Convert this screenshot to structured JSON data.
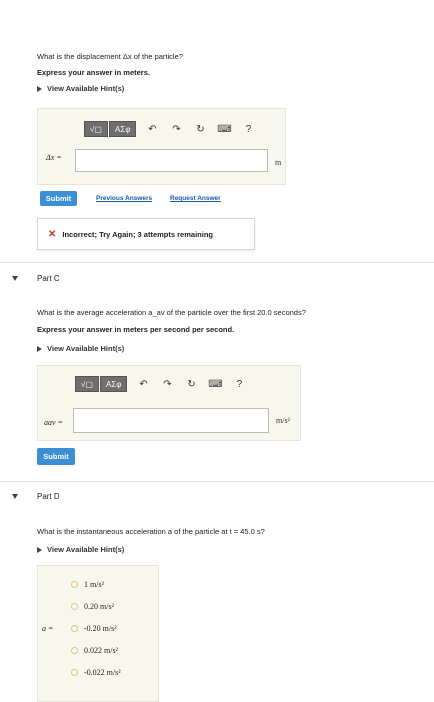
{
  "part_b": {
    "question": "What is the displacement Δx of the particle?",
    "express": "Express your answer in meters.",
    "hint_link": "View Available Hint(s)",
    "toolbar": {
      "templates": "√▢",
      "greek": "ΑΣφ",
      "undo": "↶",
      "redo": "↷",
      "reset": "↻",
      "keyboard": "⌨",
      "help": "?"
    },
    "input_label": "Δx =",
    "unit": "m",
    "submit": "Submit",
    "previous_answers": "Previous Answers",
    "request_answer": "Request Answer",
    "feedback": "Incorrect; Try Again; 3 attempts remaining"
  },
  "part_c": {
    "title": "Part C",
    "question": "What is the average acceleration a_av of the particle over the first 20.0 seconds?",
    "express": "Express your answer in meters per second per second.",
    "hint_link": "View Available Hint(s)",
    "toolbar": {
      "templates": "√▢",
      "greek": "ΑΣφ",
      "undo": "↶",
      "redo": "↷",
      "reset": "↻",
      "keyboard": "⌨",
      "help": "?"
    },
    "input_label": "aav =",
    "unit": "m/s²",
    "submit": "Submit"
  },
  "part_d": {
    "title": "Part D",
    "question": "What is the instantaneous acceleration a of the particle at t = 45.0 s?",
    "hint_link": "View Available Hint(s)",
    "input_label": "a =",
    "options": [
      "1 m/s²",
      "0.20 m/s²",
      "-0.20 m/s²",
      "0.022 m/s²",
      "-0.022 m/s²"
    ]
  }
}
